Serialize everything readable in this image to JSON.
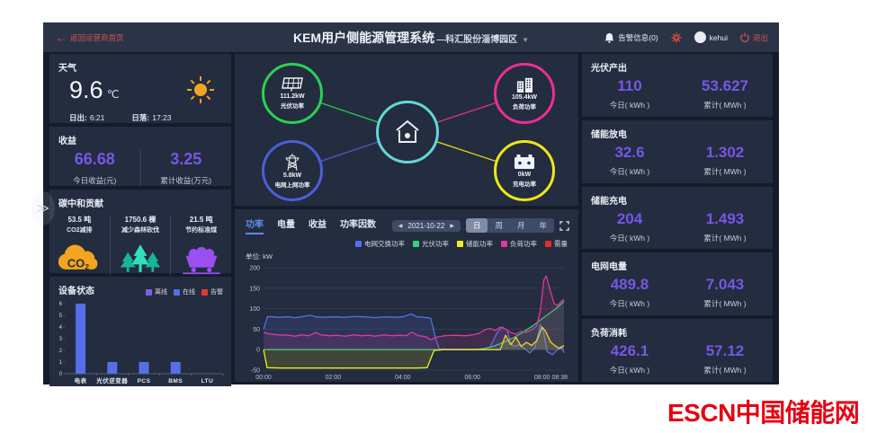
{
  "header": {
    "back_label": "返回运营商首页",
    "title": "KEM用户侧能源管理系统",
    "subtitle": "—科汇股份淄博园区",
    "alarm_label": "告警信息(0)",
    "username": "kehui",
    "logout_label": "退出"
  },
  "weather": {
    "title": "天气",
    "temperature": "9.6",
    "unit": "℃",
    "sunrise_label": "日出:",
    "sunrise_value": "6:21",
    "sunset_label": "日落:",
    "sunset_value": "17:23"
  },
  "revenue": {
    "title": "收益",
    "today_value": "66.68",
    "today_label": "今日收益(元)",
    "total_value": "3.25",
    "total_label": "累计收益(万元)"
  },
  "carbon": {
    "title": "碳中和贡献",
    "items": [
      {
        "value": "53.5 吨",
        "label": "CO2减排",
        "icon": "co2-cloud-icon",
        "color": "#f2a51e"
      },
      {
        "value": "1750.6 棵",
        "label": "减少森林砍伐",
        "icon": "trees-icon",
        "color": "#2bd9b5"
      },
      {
        "value": "21.5 吨",
        "label": "节约标准煤",
        "icon": "coal-cart-icon",
        "color": "#9b4ef2"
      }
    ]
  },
  "device_status": {
    "title": "设备状态"
  },
  "flow": {
    "center_color": "#62d8d8",
    "nodes": [
      {
        "id": "pv",
        "value": "111.2kW",
        "label": "光伏功率",
        "color": "#2bd153"
      },
      {
        "id": "load",
        "value": "105.4kW",
        "label": "负荷功率",
        "color": "#ea2f96"
      },
      {
        "id": "grid",
        "value": "5.8kW",
        "label": "电网上网功率",
        "color": "#4a5fd8"
      },
      {
        "id": "battery",
        "value": "0kW",
        "label": "充电功率",
        "color": "#efe718"
      }
    ]
  },
  "chart_panel": {
    "tabs": [
      "功率",
      "电量",
      "收益",
      "功率因数"
    ],
    "active_tab": "功率",
    "date_value": "2021-10-22",
    "prev_arrow": "◀",
    "next_arrow": "▶",
    "ranges": [
      "日",
      "周",
      "月",
      "年"
    ],
    "active_range": "日",
    "unit_label": "单位: kW"
  },
  "stats": [
    {
      "title": "光伏产出",
      "today": "110",
      "today_label": "今日( kWh )",
      "total": "53.627",
      "total_label": "累计( MWh )"
    },
    {
      "title": "储能放电",
      "today": "32.6",
      "today_label": "今日( kWh )",
      "total": "1.302",
      "total_label": "累计( MWh )"
    },
    {
      "title": "储能充电",
      "today": "204",
      "today_label": "今日( kWh )",
      "total": "1.493",
      "total_label": "累计( MWh )"
    },
    {
      "title": "电网电量",
      "today": "489.8",
      "today_label": "今日( kWh )",
      "total": "7.043",
      "total_label": "累计( MWh )"
    },
    {
      "title": "负荷消耗",
      "today": "426.1",
      "today_label": "今日( kWh )",
      "total": "57.12",
      "total_label": "累计( MWh )"
    }
  ],
  "footer": {
    "logo": "ESCN中国储能网"
  },
  "chart_data": [
    {
      "id": "power-curves",
      "type": "line",
      "title": "功率",
      "ylabel": "kW",
      "ylim": [
        -50,
        200
      ],
      "yticks": [
        200,
        150,
        100,
        50,
        0,
        -50
      ],
      "xlim": [
        0,
        8.63
      ],
      "xticks": [
        {
          "v": 0,
          "label": "00:00"
        },
        {
          "v": 2,
          "label": "02:00"
        },
        {
          "v": 4,
          "label": "04:00"
        },
        {
          "v": 6,
          "label": "06:00"
        },
        {
          "v": 8,
          "label": "08:00"
        },
        {
          "v": 8.63,
          "label": "08:38"
        }
      ],
      "legend_position": "top-right",
      "grid": true,
      "series": [
        {
          "name": "电网交换功率",
          "color": "#5470e8",
          "points": [
            [
              0,
              50
            ],
            [
              0.12,
              81
            ],
            [
              0.4,
              79
            ],
            [
              0.7,
              80
            ],
            [
              0.9,
              78
            ],
            [
              1.1,
              80
            ],
            [
              1.35,
              84
            ],
            [
              1.5,
              80
            ],
            [
              1.7,
              79
            ],
            [
              2,
              80
            ],
            [
              2.3,
              79
            ],
            [
              2.6,
              81
            ],
            [
              2.9,
              80
            ],
            [
              3.2,
              78
            ],
            [
              3.5,
              80
            ],
            [
              3.8,
              79
            ],
            [
              4,
              80
            ],
            [
              4.25,
              87
            ],
            [
              4.4,
              80
            ],
            [
              4.6,
              79
            ],
            [
              4.8,
              77
            ],
            [
              4.95,
              25
            ],
            [
              5.05,
              2
            ],
            [
              5.3,
              1
            ],
            [
              5.6,
              1
            ],
            [
              5.9,
              1
            ],
            [
              6.2,
              1
            ],
            [
              6.5,
              5
            ],
            [
              6.7,
              40
            ],
            [
              6.85,
              55
            ],
            [
              7,
              48
            ],
            [
              7.1,
              15
            ],
            [
              7.2,
              8
            ],
            [
              7.35,
              12
            ],
            [
              7.5,
              2
            ],
            [
              7.65,
              -8
            ],
            [
              7.8,
              5
            ],
            [
              7.95,
              62
            ],
            [
              8.05,
              40
            ],
            [
              8.15,
              -5
            ],
            [
              8.3,
              -12
            ],
            [
              8.45,
              0
            ],
            [
              8.55,
              8
            ],
            [
              8.63,
              -8
            ]
          ]
        },
        {
          "name": "光伏功率",
          "color": "#2fd573",
          "points": [
            [
              0,
              0
            ],
            [
              1,
              0
            ],
            [
              2,
              0
            ],
            [
              3,
              0
            ],
            [
              4,
              0
            ],
            [
              5,
              0
            ],
            [
              6,
              0
            ],
            [
              6.3,
              2
            ],
            [
              6.6,
              8
            ],
            [
              6.9,
              18
            ],
            [
              7.2,
              30
            ],
            [
              7.5,
              45
            ],
            [
              7.8,
              62
            ],
            [
              8,
              75
            ],
            [
              8.2,
              88
            ],
            [
              8.4,
              100
            ],
            [
              8.63,
              118
            ]
          ]
        },
        {
          "name": "储能功率",
          "color": "#f2ee1c",
          "points": [
            [
              0,
              0
            ],
            [
              0.1,
              -44
            ],
            [
              0.5,
              -45
            ],
            [
              1,
              -45
            ],
            [
              1.5,
              -45
            ],
            [
              2,
              -45
            ],
            [
              2.5,
              -45
            ],
            [
              3,
              -45
            ],
            [
              3.5,
              -45
            ],
            [
              4,
              -45
            ],
            [
              4.4,
              -45
            ],
            [
              4.7,
              -44
            ],
            [
              4.9,
              -2
            ],
            [
              5.2,
              0
            ],
            [
              5.6,
              0
            ],
            [
              6,
              0
            ],
            [
              6.4,
              0
            ],
            [
              6.8,
              0
            ],
            [
              6.95,
              35
            ],
            [
              7.1,
              12
            ],
            [
              7.25,
              30
            ],
            [
              7.4,
              8
            ],
            [
              7.55,
              18
            ],
            [
              7.7,
              10
            ],
            [
              7.85,
              22
            ],
            [
              8,
              55
            ],
            [
              8.1,
              45
            ],
            [
              8.25,
              18
            ],
            [
              8.4,
              8
            ],
            [
              8.5,
              3
            ],
            [
              8.63,
              10
            ]
          ]
        },
        {
          "name": "负荷功率",
          "color": "#e0389b",
          "points": [
            [
              0,
              42
            ],
            [
              0.2,
              38
            ],
            [
              0.45,
              36
            ],
            [
              0.7,
              35
            ],
            [
              0.9,
              33
            ],
            [
              1.1,
              36
            ],
            [
              1.3,
              34
            ],
            [
              1.5,
              42
            ],
            [
              1.65,
              36
            ],
            [
              1.9,
              34
            ],
            [
              2.1,
              35
            ],
            [
              2.35,
              33
            ],
            [
              2.6,
              36
            ],
            [
              2.8,
              34
            ],
            [
              3,
              35
            ],
            [
              3.2,
              33
            ],
            [
              3.45,
              36
            ],
            [
              3.7,
              34
            ],
            [
              3.9,
              35
            ],
            [
              4.1,
              34
            ],
            [
              4.25,
              43
            ],
            [
              4.45,
              34
            ],
            [
              4.65,
              32
            ],
            [
              4.8,
              24
            ],
            [
              4.95,
              30
            ],
            [
              5.2,
              34
            ],
            [
              5.5,
              35
            ],
            [
              5.8,
              34
            ],
            [
              6,
              36
            ],
            [
              6.2,
              40
            ],
            [
              6.35,
              48
            ],
            [
              6.5,
              52
            ],
            [
              6.65,
              47
            ],
            [
              6.8,
              55
            ],
            [
              6.95,
              50
            ],
            [
              7.1,
              42
            ],
            [
              7.25,
              38
            ],
            [
              7.4,
              45
            ],
            [
              7.55,
              42
            ],
            [
              7.7,
              48
            ],
            [
              7.85,
              58
            ],
            [
              7.95,
              95
            ],
            [
              8.05,
              170
            ],
            [
              8.12,
              180
            ],
            [
              8.25,
              140
            ],
            [
              8.35,
              112
            ],
            [
              8.45,
              108
            ],
            [
              8.55,
              118
            ],
            [
              8.63,
              123
            ]
          ]
        },
        {
          "name": "需量",
          "color": "#e62a2a",
          "points": []
        }
      ]
    },
    {
      "id": "device-status",
      "type": "bar",
      "categories": [
        "电表",
        "光伏逆变器",
        "PCS",
        "BMS",
        "LTU"
      ],
      "ylim": [
        0,
        6
      ],
      "yticks": [
        0,
        1,
        2,
        3,
        4,
        5,
        6
      ],
      "series": [
        {
          "name": "离线",
          "color": "#7b5fe8",
          "values": [
            0,
            0,
            0,
            0,
            0
          ]
        },
        {
          "name": "在线",
          "color": "#5470e8",
          "values": [
            6,
            1,
            1,
            1,
            0
          ]
        },
        {
          "name": "告警",
          "color": "#e03b30",
          "values": [
            0,
            0,
            0,
            0,
            0
          ]
        }
      ]
    }
  ]
}
